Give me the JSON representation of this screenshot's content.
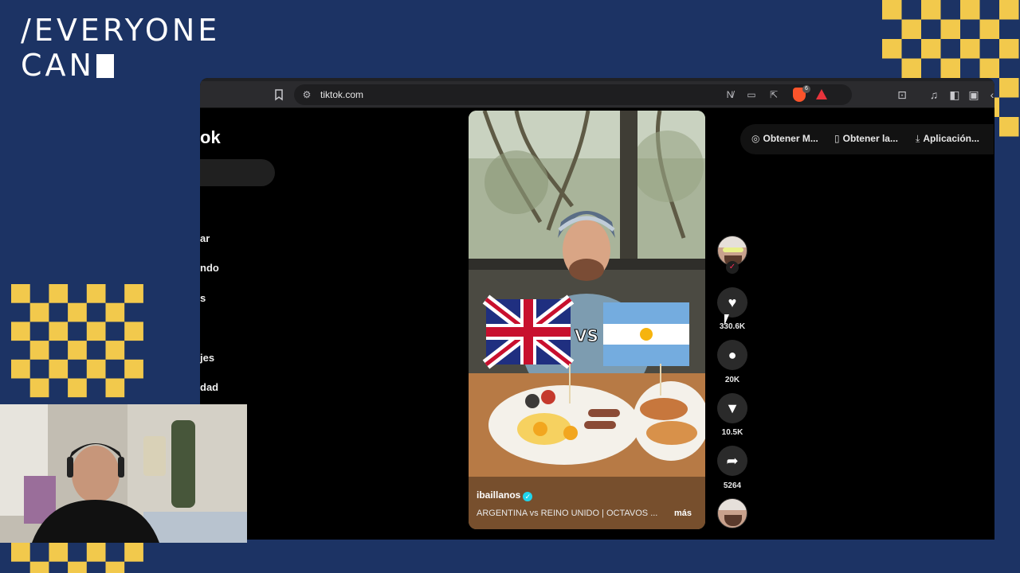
{
  "overlay": {
    "brand_line1": "/EVERYONE",
    "brand_line2": "CAN"
  },
  "browser": {
    "url": "tiktok.com",
    "shields_count": "6"
  },
  "page": {
    "logo_fragment": "ok",
    "sidebar_items": [
      "ar",
      "ndo",
      "s",
      "jes",
      "dad"
    ],
    "top_actions": [
      {
        "icon": "coin-icon",
        "glyph": "◎",
        "label": "Obtener M..."
      },
      {
        "icon": "phone-icon",
        "glyph": "▯",
        "label": "Obtener la..."
      },
      {
        "icon": "download-icon",
        "glyph": "⤓",
        "label": "Aplicación..."
      }
    ]
  },
  "video": {
    "author": "ibaillanos",
    "caption": "ARGENTINA vs REINO UNIDO | OCTAVOS ...",
    "more": "más",
    "flag_vs": "VS"
  },
  "rail": {
    "likes": "330.6K",
    "comments": "20K",
    "saves": "10.5K",
    "shares": "5264"
  },
  "colors": {
    "background": "#1c3364",
    "checker_yellow": "#f2c94c",
    "tiktok_red": "#fe2c55",
    "verified": "#20d5ec"
  }
}
